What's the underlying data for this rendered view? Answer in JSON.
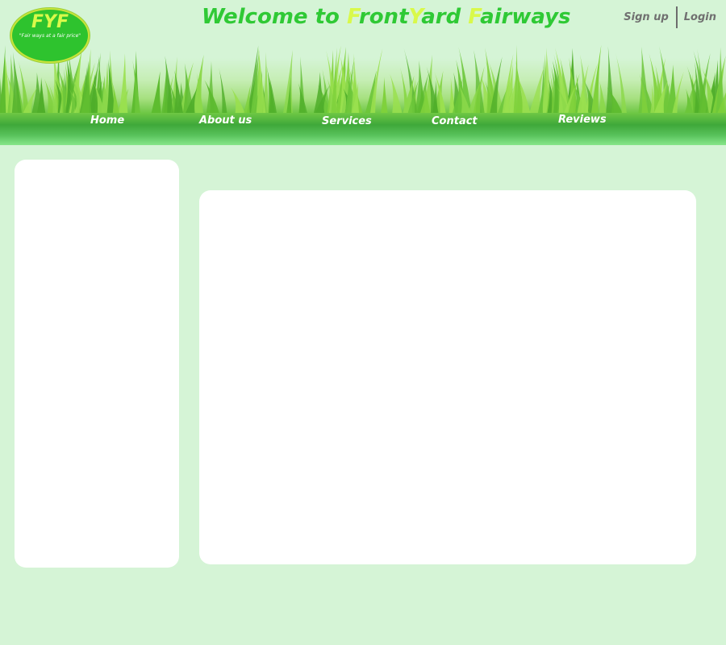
{
  "logo": {
    "text": "FYF",
    "tagline": "\"Fair ways at a fair price\""
  },
  "title": {
    "parts": [
      {
        "text": "Welcome to ",
        "accent": false
      },
      {
        "text": "F",
        "accent": true
      },
      {
        "text": "ront",
        "accent": false
      },
      {
        "text": "Y",
        "accent": true
      },
      {
        "text": "ard ",
        "accent": false
      },
      {
        "text": "F",
        "accent": true
      },
      {
        "text": "airways",
        "accent": false
      }
    ]
  },
  "auth": {
    "signup_label": "Sign up",
    "login_label": "Login"
  },
  "nav": {
    "items": [
      {
        "label": "Home"
      },
      {
        "label": "About us"
      },
      {
        "label": "Services"
      },
      {
        "label": "Contact"
      },
      {
        "label": "Reviews"
      }
    ]
  },
  "colors": {
    "page_background": "#d5f4d6",
    "title_green": "#2fc935",
    "accent_yellow": "#d9f94a",
    "logo_green": "#2ec32e",
    "nav_text": "#ffffff",
    "auth_text": "#707070"
  }
}
